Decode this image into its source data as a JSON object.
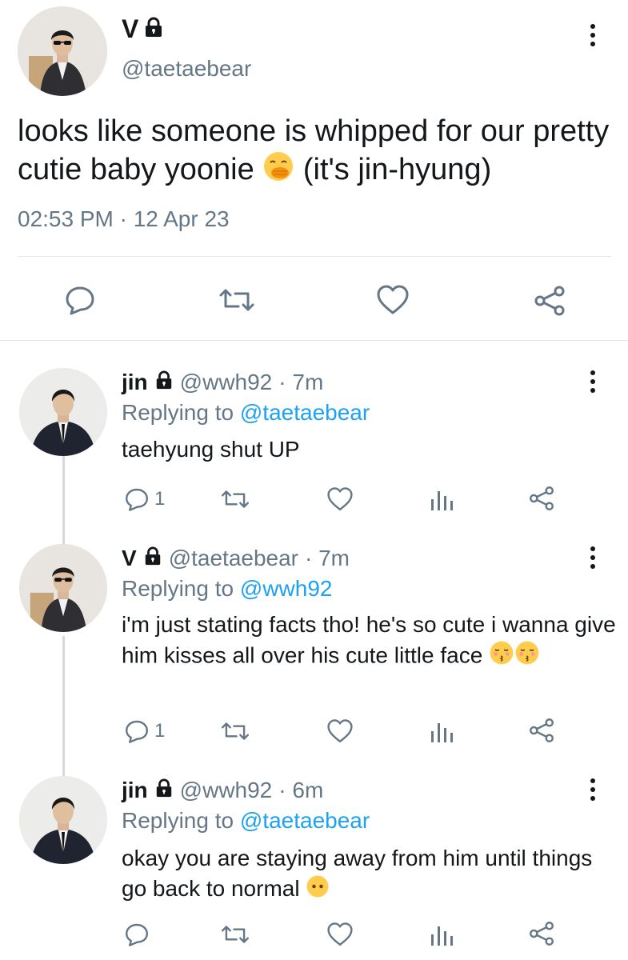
{
  "main_tweet": {
    "display_name": "V",
    "handle": "@taetaebear",
    "text": "looks like someone is whipped for our pretty cutie baby yoonie",
    "text_after_emoji": "(it's jin-hyung)",
    "emoji": "hand-over-mouth-emoji",
    "timestamp": "02:53 PM · 12 Apr 23"
  },
  "replies": [
    {
      "display_name": "jin",
      "handle": "@wwh92",
      "time": "· 7m",
      "replying_prefix": "Replying to",
      "replying_to": "@taetaebear",
      "text": "taehyung shut UP",
      "reply_count": "1"
    },
    {
      "display_name": "V",
      "handle": "@taetaebear",
      "time": "· 7m",
      "replying_prefix": "Replying to",
      "replying_to": "@wwh92",
      "text": "i'm just stating facts tho! he's so cute i wanna give him kisses all over his cute little face",
      "reply_count": "1"
    },
    {
      "display_name": "jin",
      "handle": "@wwh92",
      "time": "· 6m",
      "replying_prefix": "Replying to",
      "replying_to": "@taetaebear",
      "text": "okay you are staying away from him until things go back to normal",
      "reply_count": ""
    }
  ],
  "colors": {
    "link": "#1da1f2",
    "secondary": "#657786",
    "text": "#14171a",
    "divider": "#e1e8ed"
  }
}
